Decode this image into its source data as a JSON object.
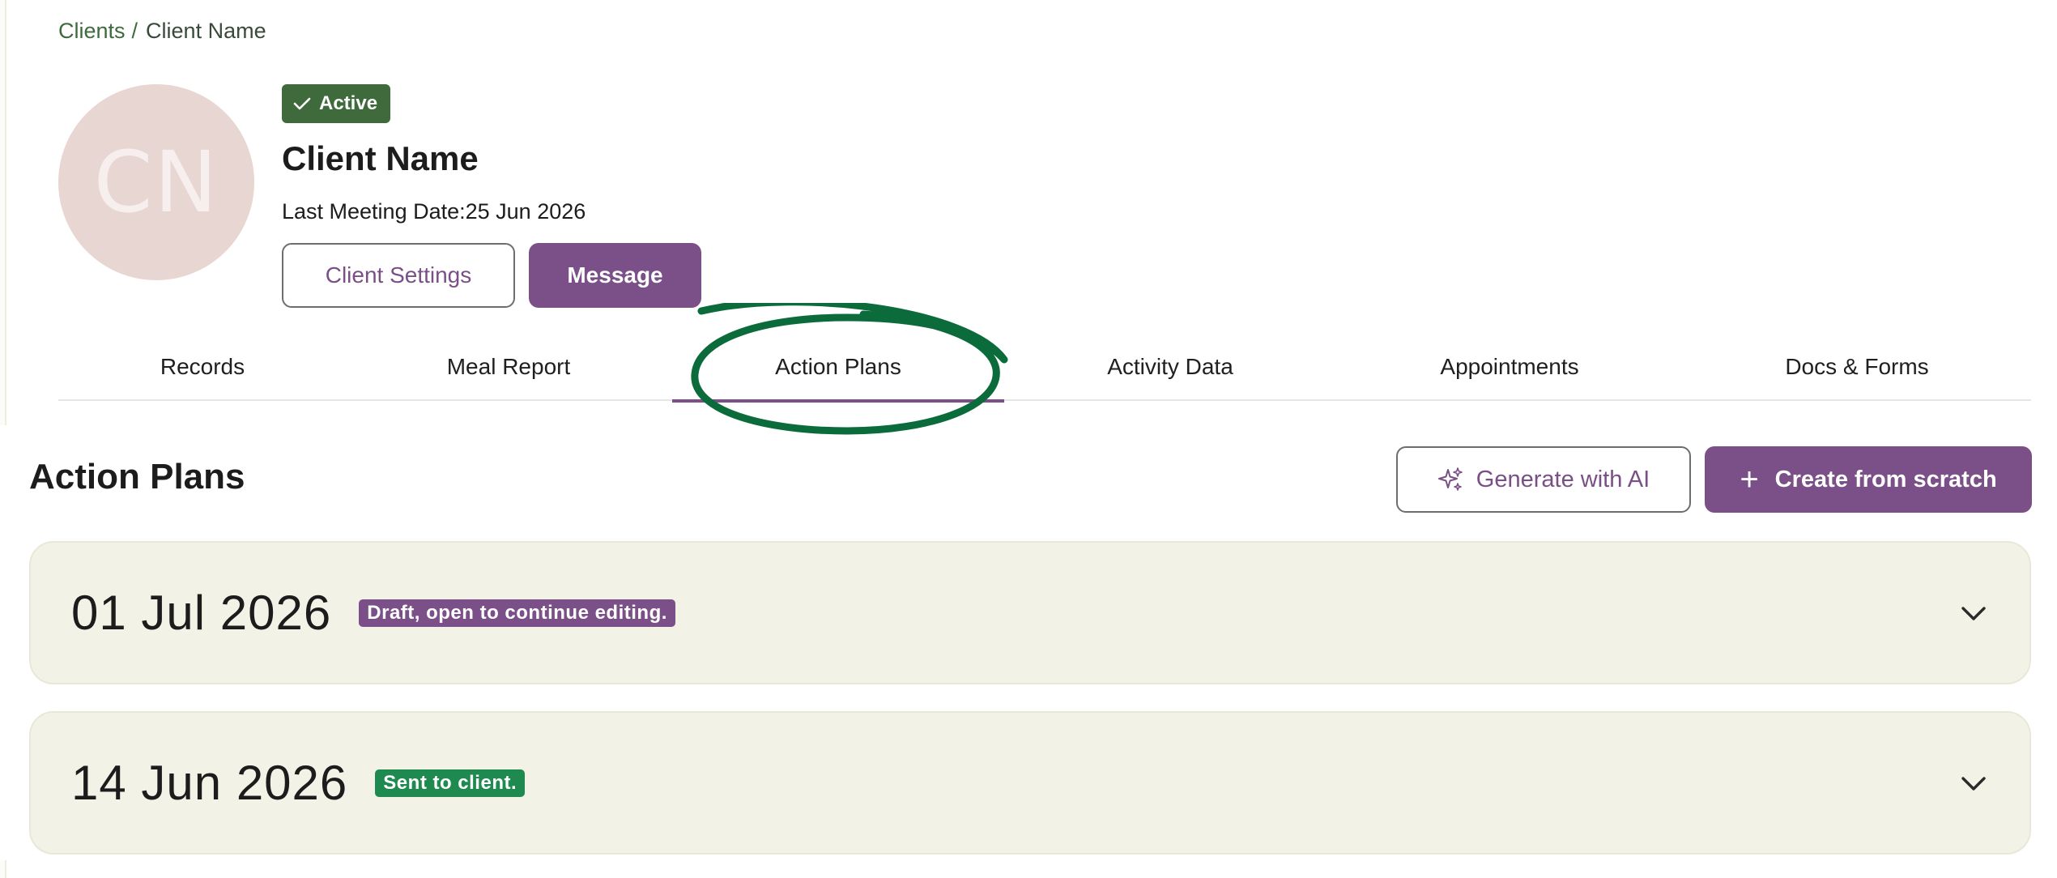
{
  "breadcrumb": {
    "parent": "Clients",
    "separator": "/",
    "current": "Client Name"
  },
  "client": {
    "initials": "CN",
    "status": "Active",
    "name": "Client Name",
    "last_meeting": "Last Meeting Date:25 Jun 2026"
  },
  "actions": {
    "settings_label": "Client Settings",
    "message_label": "Message"
  },
  "tabs": [
    {
      "label": "Records"
    },
    {
      "label": "Meal Report"
    },
    {
      "label": "Action Plans",
      "active": true
    },
    {
      "label": "Activity Data"
    },
    {
      "label": "Appointments"
    },
    {
      "label": "Docs & Forms"
    }
  ],
  "section": {
    "title": "Action Plans",
    "ai_button": "Generate with AI",
    "create_button": "Create from scratch"
  },
  "plans": [
    {
      "date": "01 Jul 2026",
      "status": "Draft, open to continue editing."
    },
    {
      "date": "14 Jun 2026",
      "status": "Sent to client."
    }
  ],
  "colors": {
    "brand_purple": "#7b4f87",
    "active_green": "#3f6b3c",
    "sent_green": "#1e8a4f",
    "card_bg": "#f3f2e6",
    "annotation_green": "#0b6b3a"
  },
  "icons": [
    "check-icon",
    "sparkles-icon",
    "plus-icon",
    "chevron-down-icon"
  ]
}
